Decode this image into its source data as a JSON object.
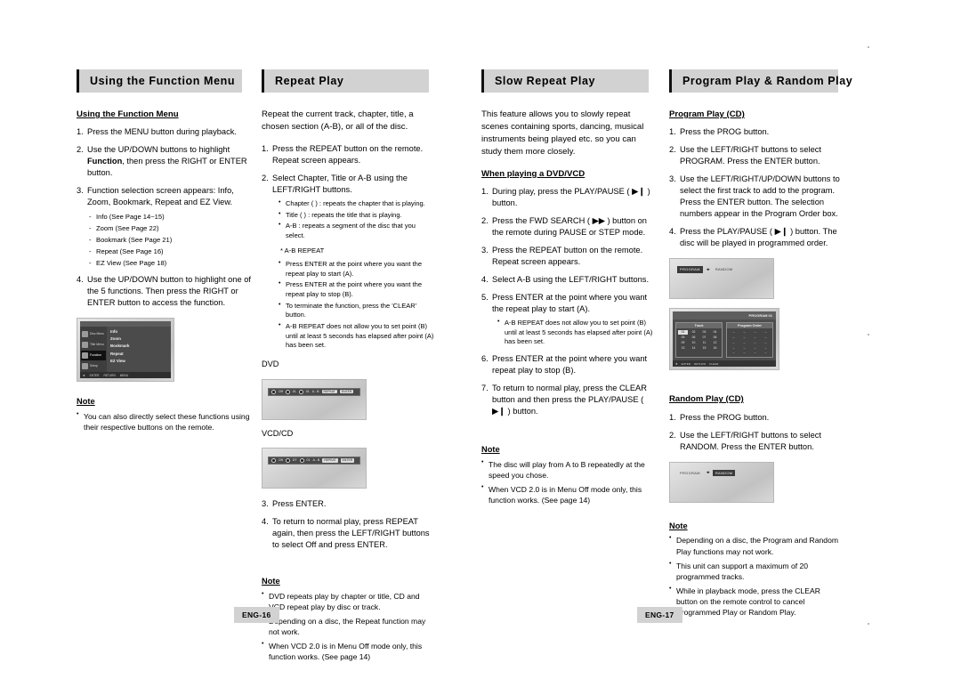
{
  "document": {
    "type": "dvd-player-user-manual-spread",
    "left_page_number": "ENG-16",
    "right_page_number": "ENG-17"
  },
  "columns": [
    {
      "header": "Using the Function Menu",
      "subhead": "Using the Function Menu",
      "steps": [
        {
          "num": "1.",
          "text": "Press the MENU button during playback."
        },
        {
          "num": "2.",
          "pre": "Use the UP/DOWN buttons to highlight ",
          "bold": "Function",
          "post": ", then press the RIGHT or ENTER button."
        },
        {
          "num": "3.",
          "text": "Function selection screen appears: Info, Zoom, Bookmark, Repeat and EZ View.",
          "sublist": [
            "Info (See Page 14~15)",
            "Zoom (See Page 22)",
            "Bookmark (See Page 21)",
            "Repeat (See Page 16)",
            "EZ View (See Page 18)"
          ]
        },
        {
          "num": "4.",
          "text": "Use the UP/DOWN button to highlight one of the 5 functions. Then press the RIGHT or ENTER button to access the function."
        }
      ],
      "screenshot": {
        "name": "function-menu-osd",
        "sidebar": [
          "Disc Menu",
          "Title Menu",
          "Function",
          "Setup"
        ],
        "selected_sidebar": "Function",
        "menu_items": [
          "Info",
          "Zoom",
          "Bookmark",
          "Repeat",
          "EZ View"
        ],
        "footer_hints": [
          "ENTER",
          "RETURN",
          "MENU"
        ]
      },
      "note": {
        "title": "Note",
        "items": [
          "You can also directly select these functions using their respective buttons on the remote."
        ]
      }
    },
    {
      "header": "Repeat Play",
      "intro": "Repeat the current track, chapter, title, a chosen section (A-B), or all of the disc.",
      "steps": [
        {
          "num": "1.",
          "text": "Press the REPEAT button on the remote. Repeat screen appears."
        },
        {
          "num": "2.",
          "text": "Select Chapter, Title or A-B using the LEFT/RIGHT buttons.",
          "bullets": [
            "Chapter (  ) : repeats the chapter that is playing.",
            "Title (  ) : repeats the title that is playing.",
            "A-B : repeats a segment of the disc that you select."
          ],
          "star": "* A-B REPEAT",
          "starbullets": [
            "Press ENTER at the point where you want the repeat play to start (A).",
            "Press ENTER at the point where you want the repeat play to stop (B).",
            "To terminate the function, press the 'CLEAR' button.",
            "A-B REPEAT does not allow you to set point (B) until at least 5 seconds has elapsed after point (A) has been set."
          ]
        }
      ],
      "shot_labels": {
        "dvd": "DVD",
        "vcdcd": "VCD/CD"
      },
      "dvd_bar": {
        "cells": [
          "Off",
          "01",
          "01",
          "A - B"
        ],
        "tags": [
          "REPEAT",
          "ENTER"
        ]
      },
      "vcdcd_bar": {
        "cells": [
          "Off",
          "DT",
          "01",
          "A - B"
        ],
        "tags": [
          "REPEAT",
          "ENTER"
        ]
      },
      "steps2": [
        {
          "num": "3.",
          "text": "Press ENTER."
        },
        {
          "num": "4.",
          "text": "To return to normal play, press REPEAT again, then press the LEFT/RIGHT buttons to select Off and press ENTER."
        }
      ],
      "note": {
        "title": "Note",
        "items": [
          "DVD repeats play by chapter or title, CD and VCD repeat play by disc or track.",
          "Depending on a disc, the Repeat function may not work.",
          "When VCD 2.0 is in Menu Off mode only, this function works. (See page 14)"
        ]
      }
    },
    {
      "header": "Slow Repeat Play",
      "intro": "This feature allows you to slowly repeat scenes containing sports, dancing, musical instruments being played etc. so you can study them more closely.",
      "subhead": "When playing a DVD/VCD",
      "steps": [
        {
          "num": "1.",
          "text": "During play, press the PLAY/PAUSE ( ▶❙ ) button."
        },
        {
          "num": "2.",
          "text": "Press the FWD SEARCH ( ▶▶ ) button on the remote during PAUSE or STEP mode."
        },
        {
          "num": "3.",
          "text": "Press the REPEAT button on the remote. Repeat screen appears."
        },
        {
          "num": "4.",
          "text": "Select A-B using the LEFT/RIGHT buttons."
        },
        {
          "num": "5.",
          "text": "Press ENTER at the point where you want the repeat play to start (A).",
          "bullets": [
            "A-B REPEAT does not allow you to set point (B) until at least 5 seconds has elapsed after point (A) has been set."
          ]
        },
        {
          "num": "6.",
          "text": "Press ENTER at the point where you want repeat play to stop (B)."
        },
        {
          "num": "7.",
          "text": "To return to normal play, press the CLEAR button and then press the PLAY/PAUSE ( ▶❙ ) button."
        }
      ],
      "note": {
        "title": "Note",
        "items": [
          "The disc will play from A to B repeatedly at the speed you chose.",
          "When VCD 2.0 is in Menu Off mode only, this function works. (See page 14)"
        ]
      }
    },
    {
      "header": "Program Play & Random Play",
      "subhead": "Program Play (CD)",
      "steps": [
        {
          "num": "1.",
          "text": "Press the PROG button."
        },
        {
          "num": "2.",
          "text": "Use the LEFT/RIGHT buttons to select PROGRAM. Press the ENTER button."
        },
        {
          "num": "3.",
          "text": "Use the LEFT/RIGHT/UP/DOWN buttons to select the first track to add to the program. Press the ENTER button. The selection numbers appear in the Program Order box."
        },
        {
          "num": "4.",
          "text": "Press the PLAY/PAUSE ( ▶❙ ) button. The disc will be played in programmed order."
        }
      ],
      "osd_program": {
        "selected": "PROGRAM",
        "other": "RANDOM"
      },
      "program_table": {
        "title": "PROGRAM 01",
        "track_header": "Track",
        "order_header": "Program Order",
        "tracks": [
          "01",
          "02",
          "03",
          "04",
          "05",
          "06",
          "07",
          "08",
          "09",
          "10",
          "11",
          "12",
          "13",
          "14",
          "15",
          "16"
        ],
        "selected_track": "01",
        "order_cells": [
          "--",
          "--",
          "--",
          "--",
          "--",
          "--",
          "--",
          "--",
          "--",
          "--",
          "--",
          "--",
          "--",
          "--",
          "--",
          "--",
          "--",
          "--",
          "--",
          "--"
        ],
        "footer_hints": [
          "ENTER",
          "RETURN",
          "CLEAR"
        ]
      },
      "subhead2": "Random Play (CD)",
      "steps2": [
        {
          "num": "1.",
          "text": "Press the PROG button."
        },
        {
          "num": "2.",
          "text": "Use the LEFT/RIGHT buttons to select RANDOM. Press the ENTER button."
        }
      ],
      "osd_random": {
        "selected": "RANDOM",
        "other": "PROGRAM"
      },
      "note": {
        "title": "Note",
        "items": [
          "Depending on a disc, the Program and Random Play functions may not work.",
          "This unit can support a maximum of 20 programmed tracks.",
          "While in playback mode, press the CLEAR button on the remote control to cancel Programmed Play or Random Play."
        ]
      }
    }
  ]
}
